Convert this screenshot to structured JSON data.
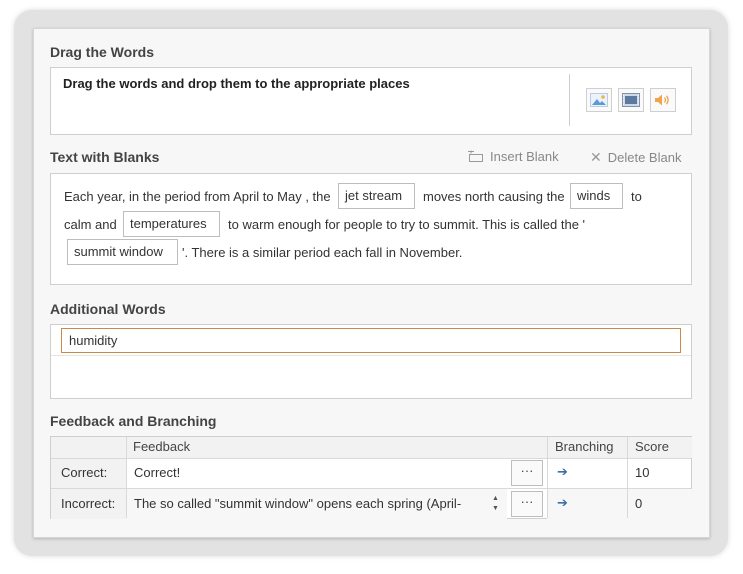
{
  "drag_words": {
    "title": "Drag the Words",
    "instruction": "Drag the words and drop them to the appropriate places",
    "media_buttons": [
      "image-icon",
      "video-icon",
      "audio-icon"
    ]
  },
  "text_blanks": {
    "title": "Text with Blanks",
    "insert_label": "Insert Blank",
    "delete_label": "Delete Blank",
    "seg1": "Each year, in the period from April to May , the",
    "blank1": "jet stream",
    "seg2": "moves north causing the",
    "blank2": "winds",
    "seg3": "to",
    "seg4": "calm and",
    "blank3": "temperatures",
    "seg5": "to warm enough for people to try to summit. This is called the '",
    "blank4": "summit window",
    "seg6": "'. There is a similar period each fall in November."
  },
  "additional_words": {
    "title": "Additional Words",
    "value": "humidity"
  },
  "feedback": {
    "title": "Feedback and Branching",
    "headers": {
      "feedback": "Feedback",
      "branching": "Branching",
      "score": "Score"
    },
    "rows": [
      {
        "label": "Correct:",
        "feedback": "Correct!",
        "more": "···",
        "score": "10"
      },
      {
        "label": "Incorrect:",
        "feedback": "The so called \"summit window\" opens each spring (April-",
        "more": "···",
        "score": "0"
      }
    ],
    "accent": "#3c6fa8"
  }
}
